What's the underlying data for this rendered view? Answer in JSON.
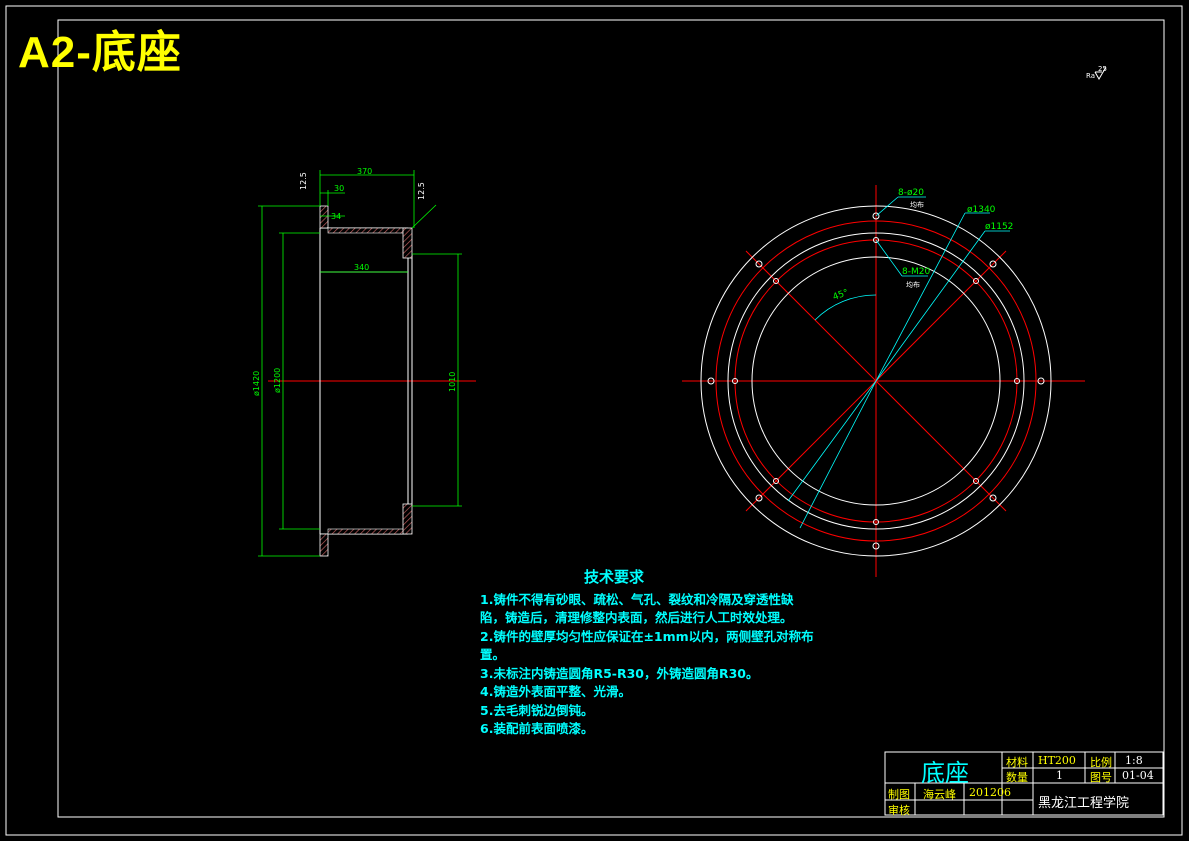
{
  "sheet_title": "A2-底座",
  "roughness_corner": "25",
  "section_view": {
    "dims": {
      "top_370": "370",
      "d30": "30",
      "d12_5": "12.5",
      "d12_5_right": "12.5",
      "d34": "34",
      "d340": "340",
      "phi1420": "ø1420",
      "phi1200": "ø1200",
      "d1010": "1010"
    }
  },
  "plan_view": {
    "holes_top": "8-ø20",
    "holes_top_note": "均布",
    "phi1340": "ø1340",
    "phi1152": "ø1152",
    "holes_thread": "8-M20",
    "holes_thread_note": "均布",
    "angle": "45°"
  },
  "tech_requirements": {
    "heading": "技术要求",
    "lines": [
      "1.铸件不得有砂眼、疏松、气孔、裂纹和冷隔及穿透性缺",
      "陷，铸造后，清理修整内表面，然后进行人工时效处理。",
      "2.铸件的壁厚均匀性应保证在±1mm以内，两侧壁孔对称布",
      "置。",
      "3.未标注内铸造圆角R5-R30，外铸造圆角R30。",
      "4.铸造外表面平整、光滑。",
      "5.去毛刺锐边倒钝。",
      "6.装配前表面喷漆。"
    ]
  },
  "title_block": {
    "part_name": "底座",
    "material_label": "材料",
    "material": "HT200",
    "scale_label": "比例",
    "scale": "1:8",
    "qty_label": "数量",
    "qty": "1",
    "drawing_no_label": "图号",
    "drawing_no": "01-04",
    "drawn_label": "制图",
    "drawn_by": "海云峰",
    "date": "201206",
    "checked_label": "审核",
    "school": "黑龙江工程学院"
  },
  "colors": {
    "background": "#000000",
    "frame": "#ffffff",
    "dimension": "#00ff00",
    "centerline": "#ff0000",
    "notes": "#00ffff",
    "title": "#ffff00"
  }
}
